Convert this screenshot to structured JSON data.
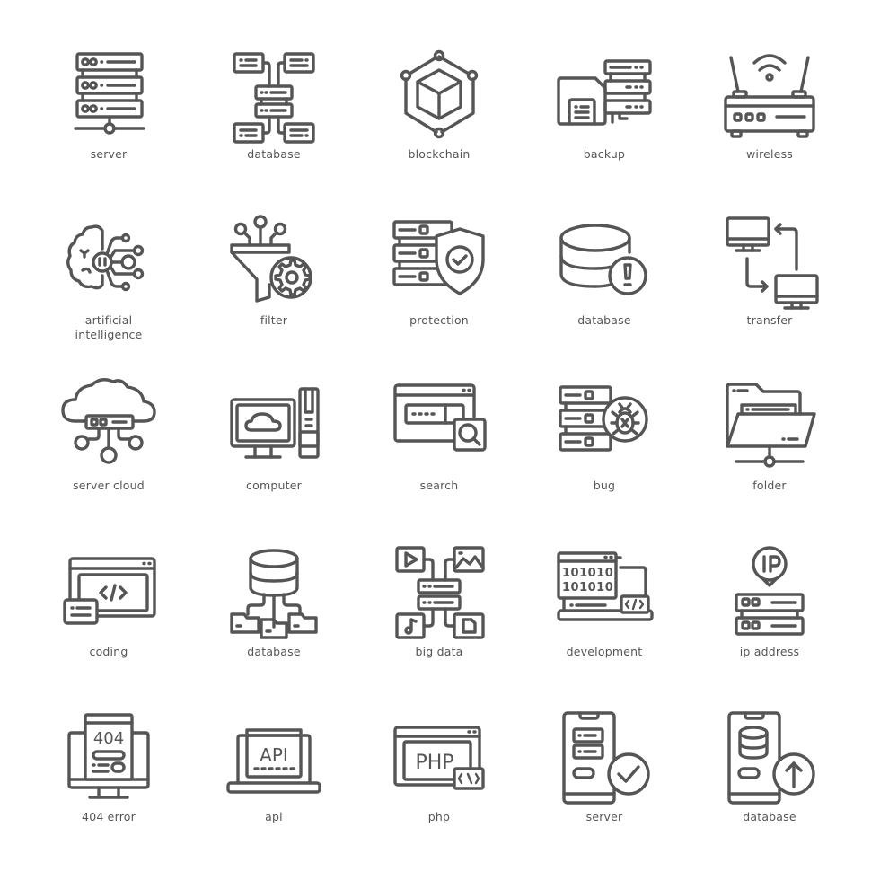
{
  "icon_set": {
    "stroke_color": "#555555",
    "background": "#ffffff",
    "rows": [
      [
        {
          "icon": "server-icon",
          "label": "server"
        },
        {
          "icon": "database-network-icon",
          "label": "database"
        },
        {
          "icon": "blockchain-icon",
          "label": "blockchain"
        },
        {
          "icon": "backup-icon",
          "label": "backup"
        },
        {
          "icon": "wireless-router-icon",
          "label": "wireless"
        }
      ],
      [
        {
          "icon": "ai-brain-icon",
          "label": "artificial\nintelligence"
        },
        {
          "icon": "filter-gear-icon",
          "label": "filter"
        },
        {
          "icon": "server-shield-icon",
          "label": "protection"
        },
        {
          "icon": "database-alert-icon",
          "label": "database"
        },
        {
          "icon": "computer-transfer-icon",
          "label": "transfer"
        }
      ],
      [
        {
          "icon": "server-cloud-icon",
          "label": "server cloud"
        },
        {
          "icon": "desktop-computer-icon",
          "label": "computer"
        },
        {
          "icon": "browser-search-icon",
          "label": "search"
        },
        {
          "icon": "server-bug-icon",
          "label": "bug"
        },
        {
          "icon": "network-folder-icon",
          "label": "folder"
        }
      ],
      [
        {
          "icon": "coding-window-icon",
          "label": "coding"
        },
        {
          "icon": "database-folders-icon",
          "label": "database"
        },
        {
          "icon": "big-data-icon",
          "label": "big data"
        },
        {
          "icon": "development-laptop-icon",
          "label": "development"
        },
        {
          "icon": "ip-server-icon",
          "label": "ip address"
        }
      ],
      [
        {
          "icon": "error-404-monitor-icon",
          "label": "404 error",
          "text": "404"
        },
        {
          "icon": "api-laptop-icon",
          "label": "api",
          "text": "API"
        },
        {
          "icon": "php-window-icon",
          "label": "php",
          "text": "PHP"
        },
        {
          "icon": "mobile-server-check-icon",
          "label": "server"
        },
        {
          "icon": "mobile-database-upload-icon",
          "label": "database"
        }
      ]
    ]
  }
}
